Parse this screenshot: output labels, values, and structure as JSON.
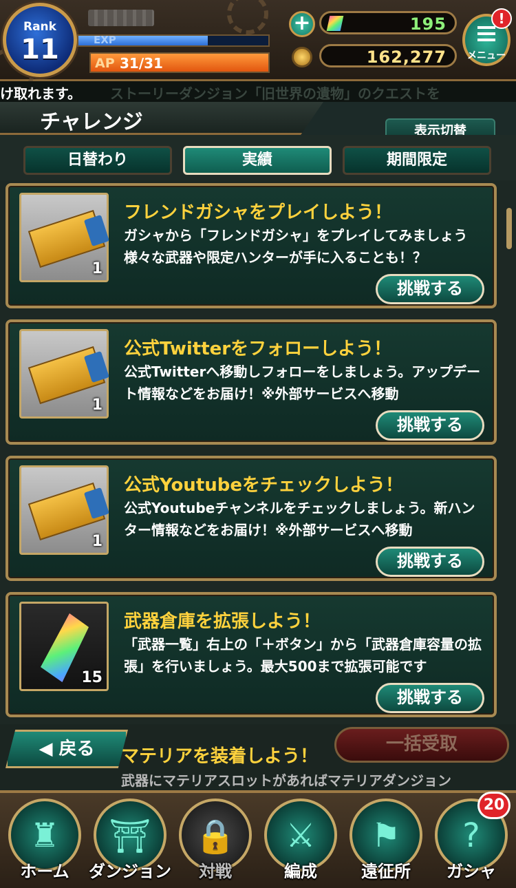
{
  "status": {
    "rank_label": "Rank",
    "rank_value": "11",
    "exp_label": "EXP",
    "exp_progress": 0.68,
    "ap_label": "AP",
    "ap_value": "31/31",
    "ap_progress": 1.0,
    "gems": "195",
    "gold": "162,277",
    "menu_label": "メニュー",
    "menu_alert": "!"
  },
  "ticker": {
    "text": "け取れます。",
    "faded_text": "ストーリーダンジョン「旧世界の遺物」のクエストを"
  },
  "header": {
    "title": "チャレンジ",
    "toggle_label": "表示切替"
  },
  "tabs": [
    {
      "label": "日替わり",
      "active": false
    },
    {
      "label": "実績",
      "active": true
    },
    {
      "label": "期間限定",
      "active": false
    }
  ],
  "challenges": [
    {
      "title": "フレンドガシャをプレイしよう！",
      "desc": "ガシャから「フレンドガシャ」をプレイしてみましょう 様々な武器や限定ハンターが手に入ることも！？",
      "reward_icon": "ticket-icon",
      "quantity": "1",
      "button": "挑戦する"
    },
    {
      "title": "公式Twitterをフォローしよう！",
      "desc": "公式Twitterへ移動しフォローをしましょう。アップデート情報などをお届け！※外部サービスへ移動",
      "reward_icon": "ticket-icon",
      "quantity": "1",
      "button": "挑戦する"
    },
    {
      "title": "公式Youtubeをチェックしよう！",
      "desc": "公式Youtubeチャンネルをチェックしましょう。新ハンター情報などをお届け！※外部サービスへ移動",
      "reward_icon": "ticket-icon",
      "quantity": "1",
      "button": "挑戦する"
    },
    {
      "title": "武器倉庫を拡張しよう！",
      "desc": "「武器一覧」右上の「＋ボタン」から「武器倉庫容量の拡張」を行いましょう。最大500まで拡張可能です",
      "reward_icon": "crystal-icon",
      "quantity": "15",
      "button": "挑戦する"
    }
  ],
  "peek": {
    "title": "マテリアを装着しよう！",
    "desc": "武器にマテリアスロットがあればマテリアダンジョン"
  },
  "actions": {
    "back": "◀ 戻る",
    "receive_all": "一括受取"
  },
  "nav": [
    {
      "label": "ホーム",
      "icon": "castle-icon",
      "glyph": "♜"
    },
    {
      "label": "ダンジョン",
      "icon": "gate-icon",
      "glyph": "⛩"
    },
    {
      "label": "対戦",
      "icon": "lock-icon",
      "glyph": "🔒",
      "locked": true
    },
    {
      "label": "編成",
      "icon": "party-icon",
      "glyph": "⚔"
    },
    {
      "label": "遠征所",
      "icon": "flag-icon",
      "glyph": "⚑"
    },
    {
      "label": "ガシャ",
      "icon": "gacha-icon",
      "glyph": "?"
    }
  ],
  "gacha_badge": "20",
  "colors": {
    "accent_teal": "#1f8a77",
    "title_gold": "#ffd23d",
    "frame_gold": "#a88a52",
    "alert_red": "#e0242a"
  }
}
